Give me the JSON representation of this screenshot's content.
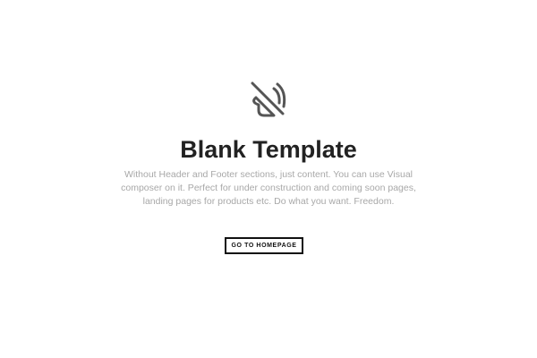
{
  "hero": {
    "icon": "mute-speaker-icon",
    "title": "Blank Template",
    "description_lines": [
      "Without Header and Footer sections, just content. You can use Visual",
      "composer on it. Perfect for under construction and coming soon pages,",
      "landing pages for products etc. Do what you want. Freedom."
    ]
  },
  "actions": {
    "home_button_label": "GO TO HOMEPAGE"
  },
  "colors": {
    "title": "#222222",
    "description": "#a8a8a8",
    "icon_stroke": "#555555",
    "button_border": "#111111",
    "background": "#ffffff"
  }
}
